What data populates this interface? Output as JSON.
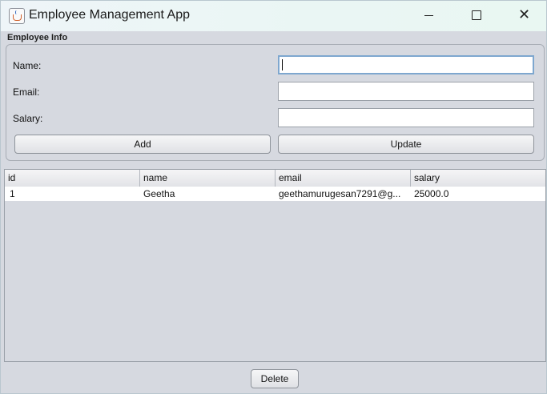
{
  "window": {
    "title": "Employee Management App",
    "icon": "java-cup-icon",
    "controls": {
      "minimize": "minimize-icon",
      "maximize": "maximize-icon",
      "close": "✕"
    }
  },
  "form": {
    "section_label": "Employee Info",
    "fields": [
      {
        "label": "Name:",
        "value": "",
        "focused": true
      },
      {
        "label": "Email:",
        "value": ""
      },
      {
        "label": "Salary:",
        "value": ""
      }
    ],
    "add_label": "Add",
    "update_label": "Update"
  },
  "table": {
    "columns": [
      "id",
      "name",
      "email",
      "salary"
    ],
    "rows": [
      [
        "1",
        "Geetha",
        "geethamurugesan7291@g...",
        "25000.0"
      ]
    ]
  },
  "footer": {
    "delete_label": "Delete"
  }
}
